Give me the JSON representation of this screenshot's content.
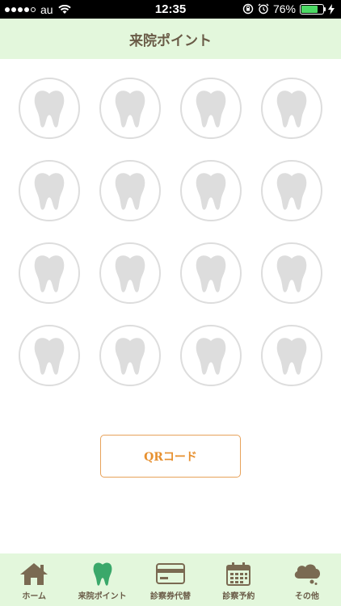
{
  "status_bar": {
    "carrier": "au",
    "time": "12:35",
    "battery_percent": "76%",
    "battery_level": 0.76,
    "signal_bars": 4
  },
  "header": {
    "title": "来院ポイント"
  },
  "stamps": {
    "count": 16,
    "filled": 0,
    "icon": "tooth-icon"
  },
  "qr_button": {
    "label": "QRコード"
  },
  "tabbar": {
    "items": [
      {
        "label": "ホーム",
        "icon": "home-icon"
      },
      {
        "label": "来院ポイント",
        "icon": "tooth-icon",
        "active": true
      },
      {
        "label": "診察券代替",
        "icon": "card-icon"
      },
      {
        "label": "診察予約",
        "icon": "calendar-icon"
      },
      {
        "label": "その他",
        "icon": "cloud-icon"
      }
    ]
  },
  "colors": {
    "header_bg": "#e3f7dc",
    "title_text": "#6a5b47",
    "stamp_empty": "#dddddd",
    "accent_orange": "#e7902f",
    "active_tab": "#3aa86a",
    "tab_icon": "#7a6a52"
  }
}
